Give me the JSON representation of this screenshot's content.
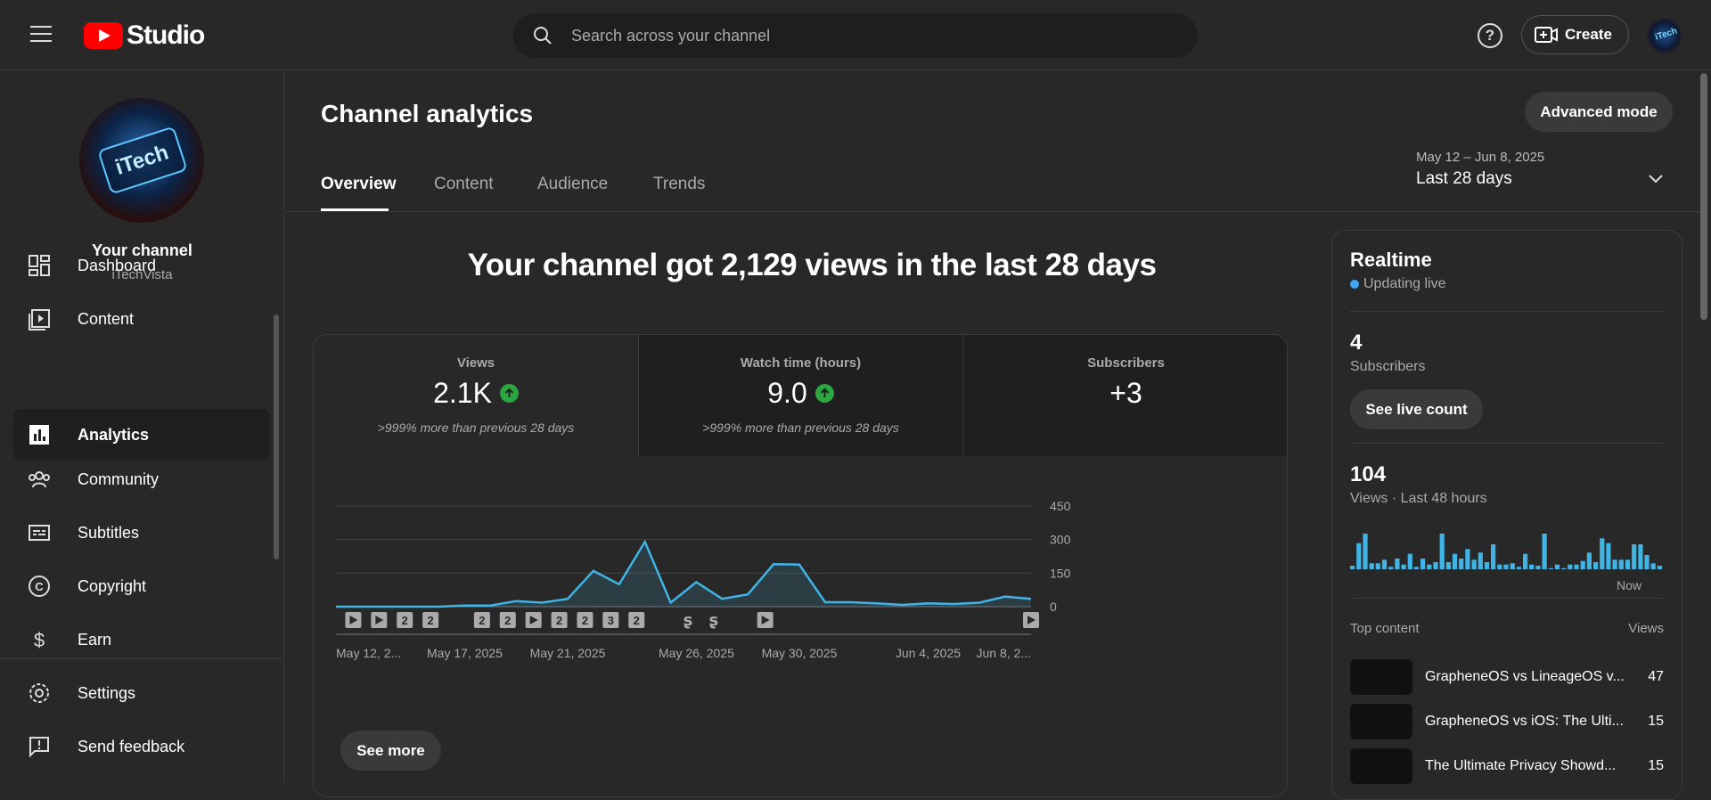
{
  "header": {
    "logo_text": "Studio",
    "search_placeholder": "Search across your channel",
    "help_label": "?",
    "create_label": "Create",
    "avatar_text": "iTech"
  },
  "sidebar": {
    "avatar_text": "iTech",
    "your_channel": "Your channel",
    "channel_name": "iTechVista",
    "items": [
      {
        "label": "Dashboard",
        "icon": "dashboard-icon"
      },
      {
        "label": "Content",
        "icon": "content-icon"
      },
      {
        "label": "Analytics",
        "icon": "analytics-icon",
        "active": true
      },
      {
        "label": "Community",
        "icon": "community-icon"
      },
      {
        "label": "Subtitles",
        "icon": "subtitles-icon"
      },
      {
        "label": "Copyright",
        "icon": "copyright-icon"
      },
      {
        "label": "Earn",
        "icon": "dollar-icon"
      }
    ],
    "bottom_items": [
      {
        "label": "Settings",
        "icon": "gear-icon"
      },
      {
        "label": "Send feedback",
        "icon": "feedback-icon"
      }
    ]
  },
  "main": {
    "title": "Channel analytics",
    "advanced_mode": "Advanced mode",
    "tabs": [
      "Overview",
      "Content",
      "Audience",
      "Trends"
    ],
    "active_tab": "Overview",
    "date_range": "May 12 – Jun 8, 2025",
    "date_label": "Last 28 days",
    "headline": "Your channel got 2,129 views in the last 28 days",
    "see_more": "See more"
  },
  "metrics": [
    {
      "label": "Views",
      "value": "2.1K",
      "trend": "up",
      "comparison": ">999% more than previous 28 days"
    },
    {
      "label": "Watch time (hours)",
      "value": "9.0",
      "trend": "up",
      "comparison": ">999% more than previous 28 days"
    },
    {
      "label": "Subscribers",
      "value": "+3",
      "trend": "none",
      "comparison": ""
    }
  ],
  "chart_data": {
    "type": "area",
    "series": [
      {
        "name": "Views",
        "values": [
          0,
          0,
          0,
          0,
          0,
          5,
          5,
          25,
          18,
          35,
          160,
          100,
          290,
          18,
          110,
          35,
          55,
          190,
          188,
          20,
          20,
          15,
          8,
          15,
          12,
          18,
          45,
          35
        ]
      }
    ],
    "x_tick_labels": [
      "May 12, 2...",
      "May 17, 2025",
      "May 21, 2025",
      "May 26, 2025",
      "May 30, 2025",
      "Jun 4, 2025",
      "Jun 8, 2..."
    ],
    "y_ticks": [
      "450",
      "300",
      "150",
      "0"
    ],
    "ylim": [
      0,
      450
    ],
    "grid": true,
    "color": "#41b4e6",
    "markers": [
      "play",
      "play",
      "2",
      "2",
      "2",
      "2",
      "play",
      "2",
      "2",
      "3",
      "2",
      "shorts",
      "shorts",
      "play",
      "play"
    ]
  },
  "realtime": {
    "title": "Realtime",
    "live_label": "Updating live",
    "subscribers_value": "4",
    "subscribers_label": "Subscribers",
    "live_count_button": "See live count",
    "views_value": "104",
    "views_label": "Views · Last 48 hours",
    "now_label": "Now",
    "bars": [
      3,
      22,
      30,
      5,
      5,
      8,
      2,
      9,
      4,
      13,
      2,
      9,
      4,
      6,
      30,
      6,
      13,
      9,
      17,
      8,
      14,
      6,
      21,
      4,
      4,
      5,
      2,
      13,
      4,
      3,
      30,
      1,
      4,
      1,
      4,
      4,
      7,
      14,
      6,
      26,
      22,
      8,
      8,
      8,
      21,
      21,
      12,
      5,
      3
    ],
    "top_content_label": "Top content",
    "views_col_label": "Views",
    "top_content": [
      {
        "title": "GrapheneOS vs LineageOS v...",
        "views": "47"
      },
      {
        "title": "GrapheneOS vs iOS: The Ulti...",
        "views": "15"
      },
      {
        "title": "The Ultimate Privacy Showd...",
        "views": "15"
      }
    ]
  }
}
